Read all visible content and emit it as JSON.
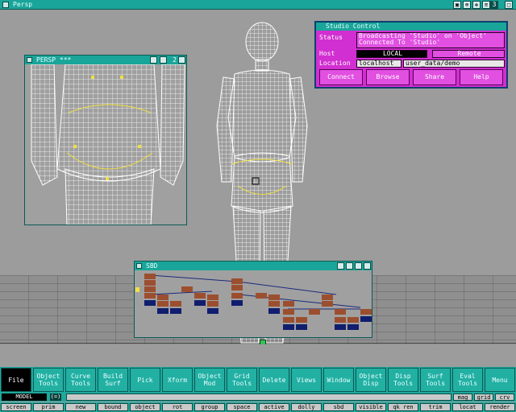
{
  "window": {
    "title": "Persp",
    "tab_count": "3"
  },
  "inset": {
    "title": "PERSP ***",
    "number": "2"
  },
  "control_panel": {
    "title": "Studio Control",
    "status_label": "Status",
    "status_text": "Broadcasting 'Studio' on 'Object' Connected To 'Studio'",
    "host_label": "Host",
    "host_value": "LOCAL",
    "host_btn": "Remote",
    "location_label": "Location",
    "location_host": "localhost",
    "location_path": "user_data/demo",
    "buttons": [
      "Connect",
      "Browse",
      "Share",
      "Help"
    ]
  },
  "sbd": {
    "title": "SBD"
  },
  "toolbar": {
    "buttons": [
      "File",
      "Object\nTools",
      "Curve\nTools",
      "Build\nSurf",
      "Pick",
      "Xform",
      "Object\nMod",
      "Grid\nTools",
      "Delete",
      "Views",
      "Window",
      "Object\nDisp",
      "Disp\nTools",
      "Surf\nTools",
      "Eval\nTools",
      "Menu"
    ]
  },
  "status": {
    "mode": "MODEL",
    "mode_btn": "(=)",
    "right_buttons": [
      "mag",
      "grid",
      "crv"
    ]
  },
  "hotkeys": [
    "screen",
    "prim",
    "new",
    "bound",
    "object",
    "rot",
    "group",
    "space",
    "active",
    "dolly",
    "sbd",
    "visible",
    "qk ren",
    "trim",
    "locat",
    "render"
  ],
  "colors": {
    "title_bar": "#1aa59a",
    "panel": "#d12fd1",
    "viewport": "#9c9c9c"
  }
}
